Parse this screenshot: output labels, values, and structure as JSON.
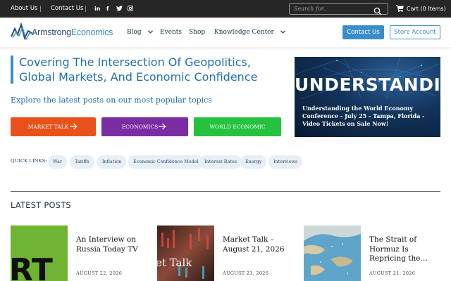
{
  "topbar": {
    "about": "About Us",
    "contact": "Contact Us",
    "social": [
      {
        "name": "linkedin-icon",
        "glyph": "in"
      },
      {
        "name": "facebook-icon",
        "glyph": "f"
      },
      {
        "name": "twitter-icon",
        "glyph": "t"
      },
      {
        "name": "instagram-icon",
        "glyph": "ig"
      }
    ],
    "search_placeholder": "Search for..",
    "cart_label": "Cart (0 Items)"
  },
  "header": {
    "logo_part1": "Armstrong",
    "logo_part2": "Economics",
    "nav": {
      "blog": "Blog",
      "events": "Events",
      "shop": "Shop",
      "knowledge": "Knowledge Center"
    },
    "contact_button": "Contact Us",
    "store_button": "Store Account"
  },
  "hero": {
    "title": "Covering The Intersection Of Geopolitics, Global Markets, And Economic Confidence",
    "subtitle": "Explore the latest posts on our most popular topics",
    "topics": [
      {
        "label": "MARKET TALK",
        "color": "#e8511a"
      },
      {
        "label": "ECONOMICS",
        "color": "#7a2ca3"
      },
      {
        "label": "WORLD ECONOMIC",
        "color": "#24c23e"
      }
    ],
    "quick_links_label": "QUICK LINKS:",
    "quick_links": [
      "War",
      "Tariffs",
      "Inflation",
      "Economic Confidence Model",
      "Interest Rates",
      "Energy",
      "Interviews"
    ]
  },
  "feature": {
    "heading": "UNDERSTANDING",
    "caption": "Understanding the World Economy Conference - July 25 - Tampa, Florida - Video Tickets on Sale Now!"
  },
  "latest": {
    "heading": "LATEST POSTS",
    "posts": [
      {
        "title": "An Interview on Russia Today TV",
        "date": "AUGUST 22, 2026",
        "thumb_text": "RT"
      },
      {
        "title": "Market Talk – August 21, 2026",
        "date": "AUGUST 21, 2026",
        "thumb_text": "et Talk"
      },
      {
        "title": "The Strait of Hormuz Is Repricing the…",
        "date": "AUGUST 21, 2026",
        "thumb_text": ""
      }
    ]
  },
  "colors": {
    "accent": "#3c8dc7",
    "title_blue": "#1f6fb0",
    "topbar": "#262626",
    "chip_bg": "#e8eef5"
  }
}
